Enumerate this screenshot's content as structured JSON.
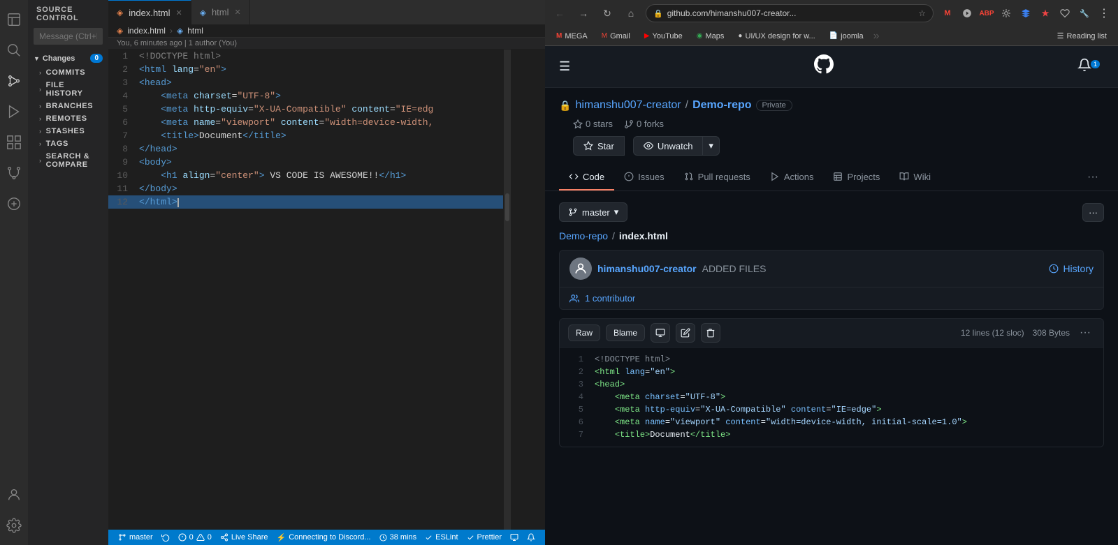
{
  "vscode": {
    "title": "SOURCE CONTROL",
    "message_placeholder": "Message (Ctrl+Enter ...)",
    "changes_label": "Changes",
    "changes_count": "0",
    "commits_label": "COMMITS",
    "file_history_label": "FILE HISTORY",
    "branches_label": "BRANCHES",
    "remotes_label": "REMOTES",
    "stashes_label": "STASHES",
    "tags_label": "TAGS",
    "search_compare_label": "SEARCH & COMPARE",
    "tab_index_html": "index.html",
    "tab_html": "html",
    "breadcrumb_file": "index.html",
    "breadcrumb_section": "html",
    "git_info": "You, 6 minutes ago | 1 author (You)",
    "code_lines": [
      {
        "num": 1,
        "content": "<!DOCTYPE html>"
      },
      {
        "num": 2,
        "content": "<html lang=\"en\">"
      },
      {
        "num": 3,
        "content": "<head>"
      },
      {
        "num": 4,
        "content": "    <meta charset=\"UTF-8\">"
      },
      {
        "num": 5,
        "content": "    <meta http-equiv=\"X-UA-Compatible\" content=\"IE=edg"
      },
      {
        "num": 6,
        "content": "    <meta name=\"viewport\" content=\"width=device-width,"
      },
      {
        "num": 7,
        "content": "    <title>Document</title>"
      },
      {
        "num": 8,
        "content": "</head>"
      },
      {
        "num": 9,
        "content": "<body>"
      },
      {
        "num": 10,
        "content": "    <h1 align=\"center\"> VS CODE IS AWESOME!!</h1>"
      },
      {
        "num": 11,
        "content": "</body>"
      },
      {
        "num": 12,
        "content": "</html>",
        "selected": true
      }
    ],
    "status_branch": "master",
    "status_sync": "",
    "status_errors": "0",
    "status_warnings": "0",
    "status_live_share": "Live Share",
    "status_discord": "Connecting to Discord...",
    "status_time": "38 mins",
    "status_eslint": "ESLint",
    "status_prettier": "Prettier"
  },
  "browser": {
    "address": "github.com/himanshu007-creator...",
    "bookmarks": [
      {
        "label": "MEGA",
        "icon": "M"
      },
      {
        "label": "Gmail",
        "icon": "G"
      },
      {
        "label": "YouTube",
        "icon": "▶"
      },
      {
        "label": "Maps",
        "icon": "◉"
      },
      {
        "label": "UI/UX design for w...",
        "icon": "●"
      },
      {
        "label": "joomla",
        "icon": "📄"
      },
      {
        "label": "Reading list",
        "icon": "☰"
      }
    ]
  },
  "github": {
    "repo_owner": "himanshu007-creator",
    "repo_name": "Demo-repo",
    "private_badge": "Private",
    "stars_count": "0 stars",
    "forks_count": "0 forks",
    "star_btn": "Star",
    "unwatch_btn": "Unwatch",
    "nav_items": [
      {
        "label": "Code",
        "active": true
      },
      {
        "label": "Issues"
      },
      {
        "label": "Pull requests"
      },
      {
        "label": "Actions"
      },
      {
        "label": "Projects"
      },
      {
        "label": "Wiki"
      }
    ],
    "branch_name": "master",
    "file_path_repo": "Demo-repo",
    "file_path_file": "index.html",
    "commit_author": "himanshu007-creator",
    "commit_message": "ADDED FILES",
    "history_btn": "History",
    "contributors": "1 contributor",
    "file_toolbar": {
      "raw": "Raw",
      "blame": "Blame",
      "lines": "12 lines (12 sloc)",
      "size": "308 Bytes"
    },
    "code_lines": [
      {
        "num": 1,
        "content": "<!DOCTYPE html>"
      },
      {
        "num": 2,
        "content": "<html lang=\"en\">"
      },
      {
        "num": 3,
        "content": "<head>"
      },
      {
        "num": 4,
        "content": "    <meta charset=\"UTF-8\">"
      },
      {
        "num": 5,
        "content": "    <meta http-equiv=\"X-UA-Compatible\" content=\"IE=edge\">"
      },
      {
        "num": 6,
        "content": "    <meta name=\"viewport\" content=\"width=device-width, initial-scale=1.0\">"
      },
      {
        "num": 7,
        "content": "    <title>Document</title>"
      }
    ]
  }
}
